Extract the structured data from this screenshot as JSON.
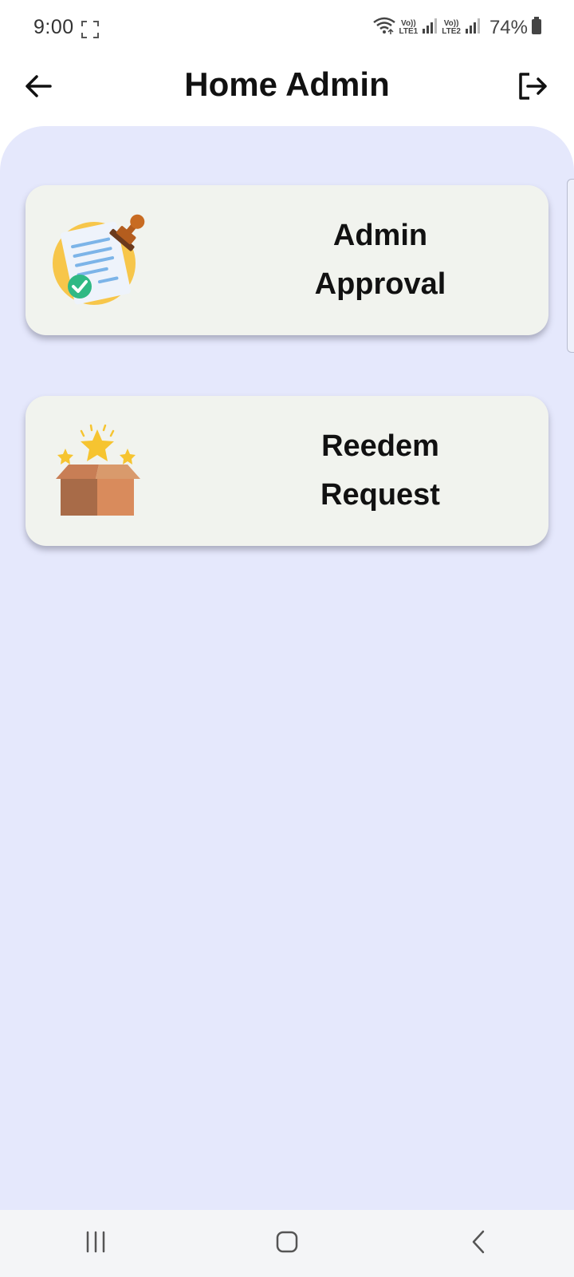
{
  "status_bar": {
    "time": "9:00",
    "sim1_top": "Vo))",
    "sim1_bottom": "LTE1",
    "sim2_top": "Vo))",
    "sim2_bottom": "LTE2",
    "battery": "74%"
  },
  "app_bar": {
    "title": "Home Admin"
  },
  "menu": [
    {
      "line1": "Admin",
      "line2": "Approval",
      "icon": "document-stamp-icon"
    },
    {
      "line1": "Reedem",
      "line2": "Request",
      "icon": "stars-box-icon"
    }
  ],
  "nav_bar": {
    "buttons": [
      "recent-apps-icon",
      "home-icon",
      "back-icon"
    ]
  },
  "colors": {
    "background": "#e5e8fc",
    "card": "#f1f3ee",
    "title": "#111111",
    "nav_bar": "#f4f5f7"
  }
}
